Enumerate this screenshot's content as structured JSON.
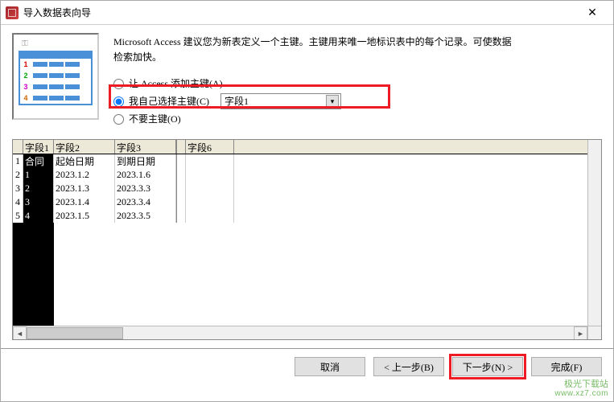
{
  "window": {
    "title": "导入数据表向导"
  },
  "instruction_line1": "Microsoft Access 建议您为新表定义一个主键。主键用来唯一地标识表中的每个记录。可使数据",
  "instruction_line2": "检索加快。",
  "radios": {
    "opt1": "让 Access 添加主键(A)",
    "opt2": "我自己选择主键(C)",
    "opt3": "不要主键(O)"
  },
  "dropdown": {
    "selected": "字段1"
  },
  "grid": {
    "headers": {
      "h1": "字段1",
      "h2": "字段2",
      "h3": "字段3",
      "h6": "字段6"
    },
    "rows": [
      {
        "n": "1",
        "c1": "合同",
        "c2": "起始日期",
        "c3": "到期日期",
        "c6": ""
      },
      {
        "n": "2",
        "c1": "1",
        "c2": "2023.1.2",
        "c3": "2023.1.6",
        "c6": ""
      },
      {
        "n": "3",
        "c1": "2",
        "c2": "2023.1.3",
        "c3": "2023.3.3",
        "c6": ""
      },
      {
        "n": "4",
        "c1": "3",
        "c2": "2023.1.4",
        "c3": "2023.3.4",
        "c6": ""
      },
      {
        "n": "5",
        "c1": "4",
        "c2": "2023.1.5",
        "c3": "2023.3.5",
        "c6": ""
      }
    ]
  },
  "buttons": {
    "cancel": "取消",
    "back": "< 上一步(B)",
    "next": "下一步(N) >",
    "finish": "完成(F)"
  },
  "watermark": {
    "line1": "极光下载站",
    "line2": "www.xz7.com"
  }
}
